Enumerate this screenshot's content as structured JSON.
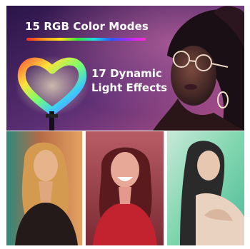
{
  "banner": {
    "headline": "15 RGB Color Modes",
    "effects_line1": "17 Dynamic",
    "effects_line2": "Light Effects"
  },
  "palette": {
    "banner_bg": "#3a1f55",
    "tile1_tint": "#c86f3f",
    "tile2_tint": "#c8323c",
    "tile3_tint": "#5ac89a"
  },
  "photos": [
    {
      "name": "woman-orange-light"
    },
    {
      "name": "woman-red-light"
    },
    {
      "name": "woman-green-light"
    }
  ]
}
